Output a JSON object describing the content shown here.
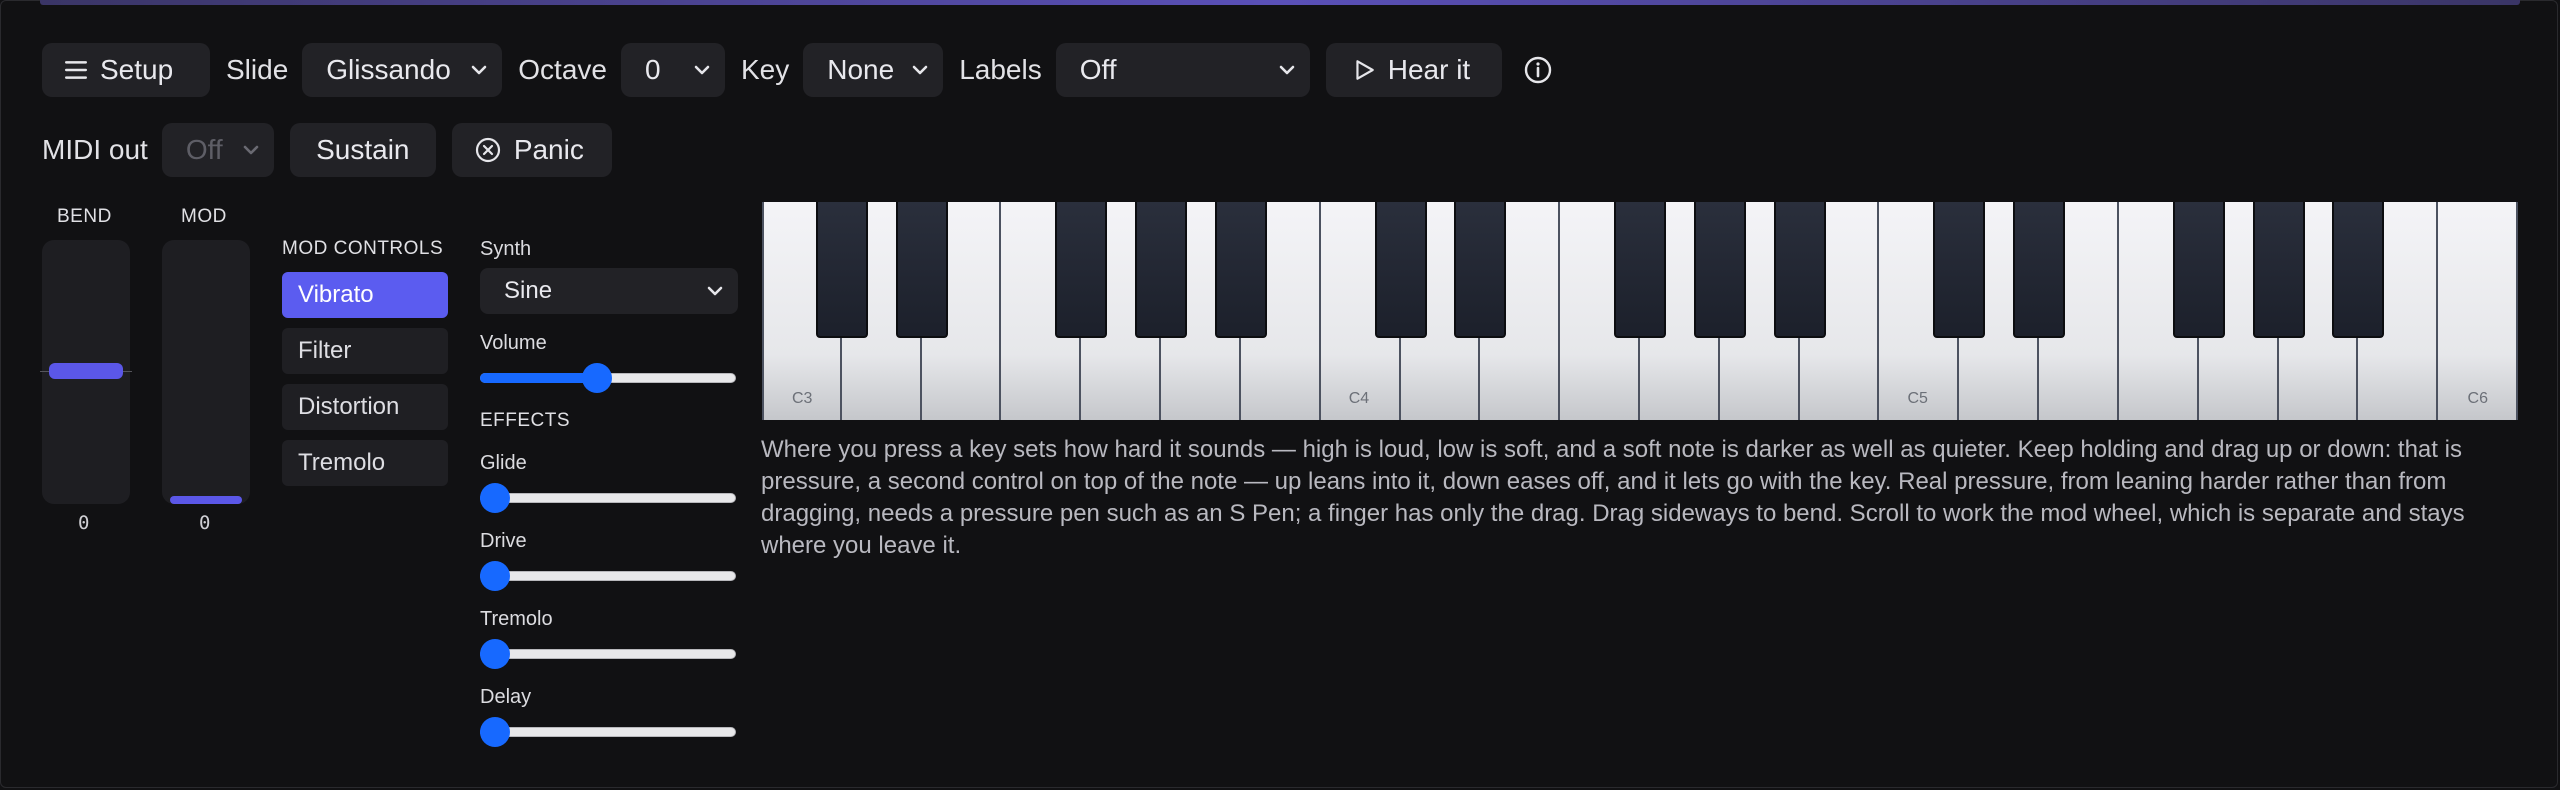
{
  "toolbar": {
    "setup_label": "Setup",
    "slide_label": "Slide",
    "slide_value": "Glissando",
    "octave_label": "Octave",
    "octave_value": "0",
    "key_label": "Key",
    "key_value": "None",
    "labels_label": "Labels",
    "labels_value": "Off",
    "hear_label": "Hear it"
  },
  "midi": {
    "midi_label": "MIDI out",
    "midi_value": "Off",
    "sustain_label": "Sustain",
    "panic_label": "Panic"
  },
  "wheels": {
    "bend_label": "BEND",
    "bend_value": "0",
    "mod_label": "MOD",
    "mod_value": "0"
  },
  "mod_controls": {
    "heading": "MOD CONTROLS",
    "items": [
      {
        "label": "Vibrato",
        "active": true
      },
      {
        "label": "Filter",
        "active": false
      },
      {
        "label": "Distortion",
        "active": false
      },
      {
        "label": "Tremolo",
        "active": false
      }
    ]
  },
  "synth": {
    "label": "Synth",
    "value": "Sine",
    "volume_label": "Volume",
    "volume_level": 0.45,
    "effects_heading": "EFFECTS",
    "effects": [
      {
        "label": "Glide",
        "level": 0
      },
      {
        "label": "Drive",
        "level": 0
      },
      {
        "label": "Tremolo",
        "level": 0
      },
      {
        "label": "Delay",
        "level": 0
      }
    ]
  },
  "keyboard": {
    "octave_labels": [
      "C3",
      "C4",
      "C5",
      "C6"
    ]
  },
  "description": "Where you press a key sets how hard it sounds — high is loud, low is soft, and a soft note is darker as well as quieter. Keep holding and drag up or down: that is pressure, a second control on top of the note — up leans into it, down eases off, and it lets go with the key. Real pressure, from leaning harder rather than from dragging, needs a pressure pen such as an S Pen; a finger has only the drag. Drag sideways to bend. Scroll to work the mod wheel, which is separate and stays where you leave it.",
  "colors": {
    "accent": "#5b5cf0",
    "slider": "#1769ff",
    "background": "#111113"
  }
}
